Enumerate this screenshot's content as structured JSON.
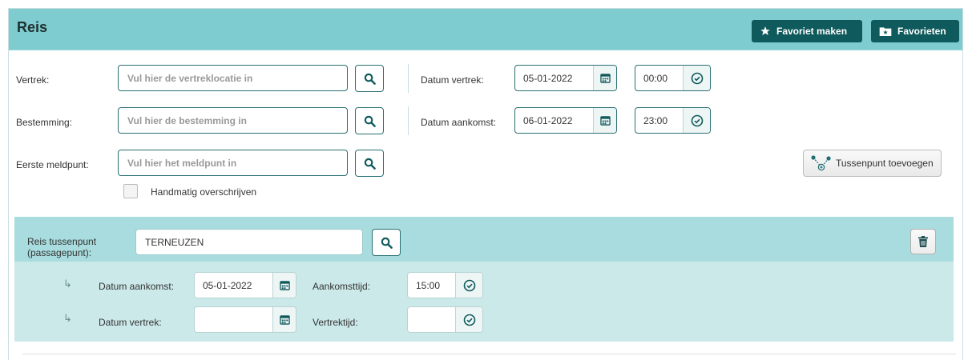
{
  "header": {
    "title": "Reis",
    "favoriet_maken_label": "Favoriet maken",
    "favorieten_label": "Favorieten"
  },
  "form": {
    "vertrek": {
      "label": "Vertrek:",
      "placeholder": "Vul hier de vertreklocatie in"
    },
    "bestemming": {
      "label": "Bestemming:",
      "placeholder": "Vul hier de bestemming in"
    },
    "eerste_meldpunt": {
      "label": "Eerste meldpunt:",
      "placeholder": "Vul hier het meldpunt in"
    },
    "handmatig_label": "Handmatig overschrijven",
    "datum_vertrek": {
      "label": "Datum vertrek:",
      "date": "05-01-2022",
      "time": "00:00"
    },
    "datum_aankomst": {
      "label": "Datum aankomst:",
      "date": "06-01-2022",
      "time": "23:00"
    },
    "tussenpunt_button": "Tussenpunt toevoegen"
  },
  "tussenpunt": {
    "label_line1": "Reis tussenpunt",
    "label_line2": "(passagepunt):",
    "value": "TERNEUZEN",
    "datum_aankomst_label": "Datum aankomst:",
    "datum_aankomst_value": "05-01-2022",
    "aankomsttijd_label": "Aankomsttijd:",
    "aankomsttijd_value": "15:00",
    "datum_vertrek_label": "Datum vertrek:",
    "datum_vertrek_value": "",
    "vertrektijd_label": "Vertrektijd:",
    "vertrektijd_value": ""
  },
  "icons": {
    "arrow": "↳"
  },
  "colors": {
    "header_bg": "#7ecccf",
    "dark_button": "#0f5a5c",
    "section_head_bg": "#a8dcde",
    "section_body_bg": "#cce9ea",
    "input_border": "#2a7074"
  }
}
